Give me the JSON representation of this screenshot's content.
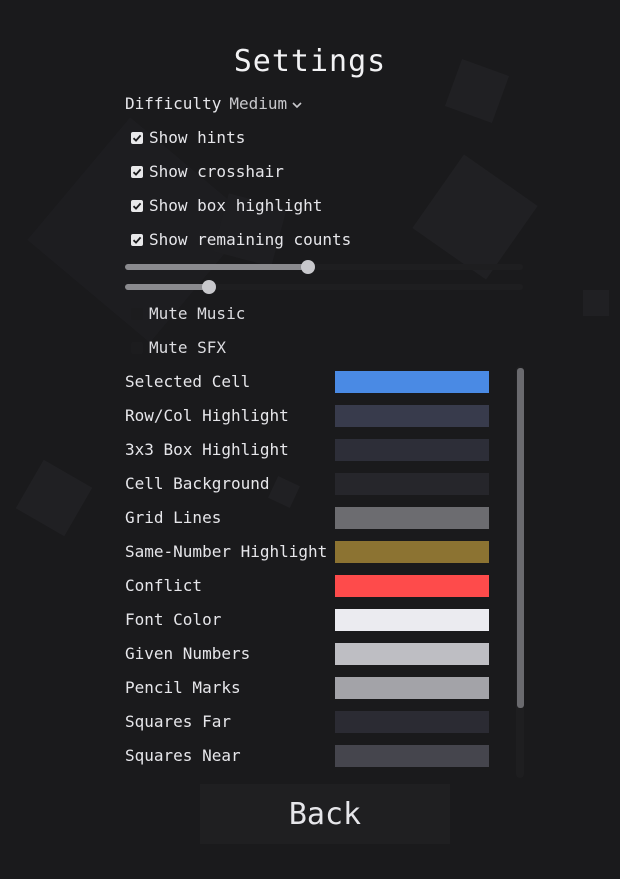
{
  "title": "Settings",
  "difficulty": {
    "label": "Difficulty",
    "value": "Medium"
  },
  "checkboxes": [
    {
      "label": "Show hints",
      "checked": true
    },
    {
      "label": "Show crosshair",
      "checked": true
    },
    {
      "label": "Show box highlight",
      "checked": true
    },
    {
      "label": "Show remaining counts",
      "checked": true
    }
  ],
  "sliders": [
    {
      "name": "music-volume",
      "value": 0.46
    },
    {
      "name": "sfx-volume",
      "value": 0.21
    }
  ],
  "mute": [
    {
      "label": "Mute Music",
      "checked": false
    },
    {
      "label": "Mute SFX",
      "checked": false
    }
  ],
  "colors": [
    {
      "label": "Selected Cell",
      "color": "#4a8ae4"
    },
    {
      "label": "Row/Col Highlight",
      "color": "#383b4c"
    },
    {
      "label": "3x3 Box Highlight",
      "color": "#2d2e38"
    },
    {
      "label": "Cell Background",
      "color": "#26262b"
    },
    {
      "label": "Grid Lines",
      "color": "#6c6c70"
    },
    {
      "label": "Same-Number Highlight",
      "color": "#8c7332"
    },
    {
      "label": "Conflict",
      "color": "#fe4b4b"
    },
    {
      "label": "Font Color",
      "color": "#ebebf0"
    },
    {
      "label": "Given Numbers",
      "color": "#bebec3"
    },
    {
      "label": "Pencil Marks",
      "color": "#a3a3a8"
    },
    {
      "label": "Squares Far",
      "color": "#2b2b33"
    },
    {
      "label": "Squares Near",
      "color": "#45454d"
    }
  ],
  "back_label": "Back"
}
